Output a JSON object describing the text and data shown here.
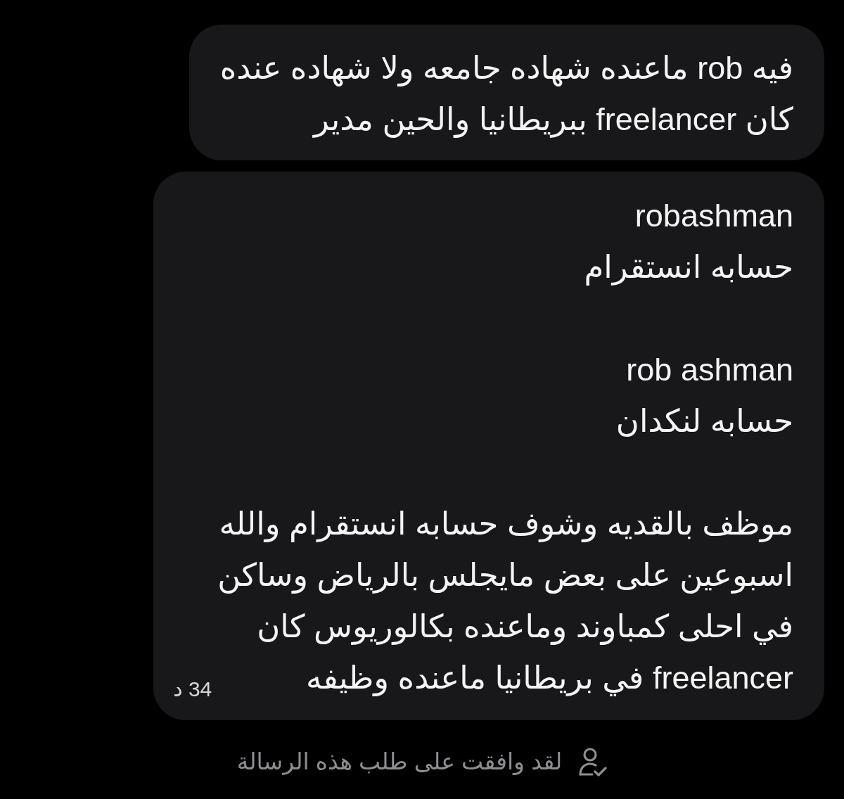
{
  "messages": [
    {
      "paragraphs": [
        "فيه rob ماعنده شهاده جامعه ولا شهاده عنده\nكان freelancer ببريطانيا والحين مدير"
      ]
    },
    {
      "paragraphs": [
        "robashman\nحسابه انستقرام",
        "rob ashman\nحسابه لنكدان",
        "موظف بالقديه وشوف حسابه انستقرام والله\nاسبوعين على بعض مايجلس بالرياض وساكن\nفي احلى كمباوند وماعنده بكالوريوس كان\nfreelancer في بريطانيا ماعنده وظيفه"
      ],
      "time": "34 د"
    }
  ],
  "request_notice": {
    "text": "لقد وافقت على طلب هذه الرسالة"
  }
}
